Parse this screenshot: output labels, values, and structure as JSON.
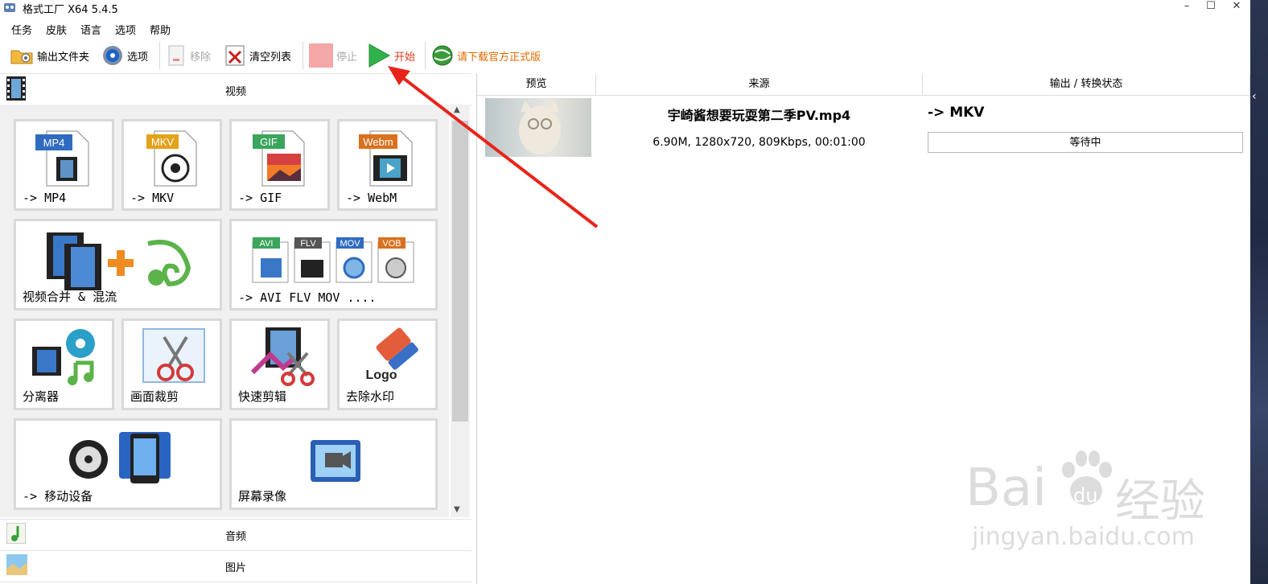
{
  "window": {
    "title": "格式工厂 X64 5.4.5",
    "controls": [
      "–",
      "☐",
      "✕"
    ]
  },
  "menu": [
    "任务",
    "皮肤",
    "语言",
    "选项",
    "帮助"
  ],
  "toolbar": {
    "output_folder": "输出文件夹",
    "options": "选项",
    "remove": "移除",
    "clear_list": "清空列表",
    "stop": "停止",
    "start": "开始",
    "download": "请下载官方正式版",
    "colors": {
      "start": "#e8381b",
      "download": "#e06a00",
      "disabled": "#a8a8a8"
    }
  },
  "categories": {
    "video": "视频",
    "audio": "音频",
    "image": "图片"
  },
  "tiles": [
    {
      "label": "-> MP4",
      "badge": "MP4",
      "badge_color": "#2f6cc0"
    },
    {
      "label": "-> MKV",
      "badge": "MKV",
      "badge_color": "#e4a21a"
    },
    {
      "label": "-> GIF",
      "badge": "GIF",
      "badge_color": "#3aa55b"
    },
    {
      "label": "-> WebM",
      "badge": "Webm",
      "badge_color": "#d9711f"
    },
    {
      "label": "视频合并 & 混流"
    },
    {
      "label": "-> AVI FLV MOV ....",
      "badges": [
        "AVI",
        "FLV",
        "MOV",
        "VOB"
      ]
    },
    {
      "label": "分离器"
    },
    {
      "label": "画面裁剪"
    },
    {
      "label": "快速剪辑"
    },
    {
      "label": "去除水印",
      "logo_text": "Logo"
    },
    {
      "label": "-> 移动设备"
    },
    {
      "label": "屏幕录像"
    }
  ],
  "table": {
    "headers": [
      "预览",
      "来源",
      "输出 / 转换状态"
    ],
    "rows": [
      {
        "filename": "宇崎酱想要玩耍第二季PV.mp4",
        "info": "6.90M, 1280x720, 809Kbps, 00:01:00",
        "output": "-> MKV",
        "status": "等待中"
      }
    ]
  },
  "watermark": {
    "brand": "Bai",
    "brand_cn": "经验",
    "du": "du",
    "url": "jingyan.baidu.com"
  }
}
